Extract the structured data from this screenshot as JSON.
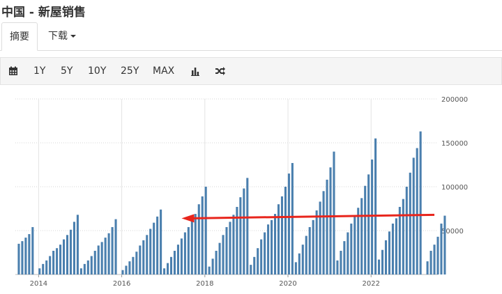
{
  "header": {
    "title": "中国 - 新屋销售"
  },
  "tabs": [
    {
      "label": "摘要",
      "active": true
    },
    {
      "label": "下载",
      "dropdown": true
    }
  ],
  "toolbar": {
    "calendar_icon": "calendar-icon",
    "ranges": [
      "1Y",
      "5Y",
      "10Y",
      "25Y",
      "MAX"
    ],
    "chart_type_icon": "bar-chart-icon",
    "compare_icon": "shuffle-icon"
  },
  "chart_data": {
    "type": "bar",
    "color": "#4a7fae",
    "title": "",
    "xlabel": "",
    "ylabel": "",
    "ylim": [
      0,
      200000
    ],
    "yticks": [
      50000,
      100000,
      150000,
      200000
    ],
    "xticks": [
      "2014",
      "2016",
      "2018",
      "2020",
      "2022"
    ],
    "series": [
      {
        "values": [
          [
            [
              "2013-08",
              35000
            ],
            [
              "2013-09",
              38000
            ],
            [
              "2013-10",
              42000
            ],
            [
              "2013-11",
              46000
            ],
            [
              "2013-12",
              54000
            ]
          ],
          [
            [
              "2014-02",
              7000
            ],
            [
              "2014-03",
              12000
            ],
            [
              "2014-04",
              16000
            ],
            [
              "2014-05",
              21000
            ],
            [
              "2014-06",
              27000
            ],
            [
              "2014-07",
              30000
            ],
            [
              "2014-08",
              34000
            ],
            [
              "2014-09",
              40000
            ],
            [
              "2014-10",
              45000
            ],
            [
              "2014-11",
              51000
            ],
            [
              "2014-12",
              60000
            ],
            [
              "2015-01",
              68000
            ]
          ],
          [
            [
              "2015-02",
              7000
            ],
            [
              "2015-03",
              12000
            ],
            [
              "2015-04",
              16000
            ],
            [
              "2015-05",
              21000
            ],
            [
              "2015-06",
              27000
            ],
            [
              "2015-07",
              33000
            ],
            [
              "2015-08",
              37000
            ],
            [
              "2015-09",
              42000
            ],
            [
              "2015-10",
              47000
            ],
            [
              "2015-11",
              54000
            ],
            [
              "2015-12",
              63000
            ]
          ],
          [
            [
              "2016-02",
              5000
            ],
            [
              "2016-03",
              10000
            ],
            [
              "2016-04",
              15000
            ],
            [
              "2016-05",
              20000
            ],
            [
              "2016-06",
              26000
            ],
            [
              "2016-07",
              33000
            ],
            [
              "2016-08",
              39000
            ],
            [
              "2016-09",
              45000
            ],
            [
              "2016-10",
              52000
            ],
            [
              "2016-11",
              59000
            ],
            [
              "2016-12",
              66000
            ],
            [
              "2017-01",
              74000
            ]
          ],
          [
            [
              "2017-02",
              7000
            ],
            [
              "2017-03",
              13000
            ],
            [
              "2017-04",
              20000
            ],
            [
              "2017-05",
              27000
            ],
            [
              "2017-06",
              34000
            ],
            [
              "2017-07",
              41000
            ],
            [
              "2017-08",
              48000
            ],
            [
              "2017-09",
              54000
            ],
            [
              "2017-10",
              62000
            ],
            [
              "2017-11",
              69000
            ],
            [
              "2017-12",
              80000
            ],
            [
              "2018-01",
              89000
            ],
            [
              "2018-02",
              100000
            ]
          ],
          [
            [
              "2018-03",
              9000
            ],
            [
              "2018-04",
              18000
            ],
            [
              "2018-05",
              27000
            ],
            [
              "2018-06",
              36000
            ],
            [
              "2018-07",
              45000
            ],
            [
              "2018-08",
              54000
            ],
            [
              "2018-09",
              60000
            ],
            [
              "2018-10",
              68000
            ],
            [
              "2018-11",
              77000
            ],
            [
              "2018-12",
              88000
            ],
            [
              "2019-01",
              98000
            ],
            [
              "2019-02",
              110000
            ]
          ],
          [
            [
              "2019-03",
              11000
            ],
            [
              "2019-04",
              20000
            ],
            [
              "2019-05",
              30000
            ],
            [
              "2019-06",
              40000
            ],
            [
              "2019-07",
              48000
            ],
            [
              "2019-08",
              57000
            ],
            [
              "2019-09",
              62000
            ],
            [
              "2019-10",
              69000
            ],
            [
              "2019-11",
              80000
            ],
            [
              "2019-12",
              89000
            ],
            [
              "2020-01",
              100000
            ],
            [
              "2020-02",
              115000
            ],
            [
              "2020-03",
              127000
            ]
          ],
          [
            [
              "2020-04",
              14000
            ],
            [
              "2020-05",
              24000
            ],
            [
              "2020-06",
              34000
            ],
            [
              "2020-07",
              44000
            ],
            [
              "2020-08",
              54000
            ],
            [
              "2020-09",
              62000
            ],
            [
              "2020-10",
              73000
            ],
            [
              "2020-11",
              83000
            ],
            [
              "2020-12",
              95000
            ],
            [
              "2021-01",
              108000
            ],
            [
              "2021-02",
              122000
            ],
            [
              "2021-03",
              140000
            ]
          ],
          [
            [
              "2021-04",
              16000
            ],
            [
              "2021-05",
              27000
            ],
            [
              "2021-06",
              38000
            ],
            [
              "2021-07",
              48000
            ],
            [
              "2021-08",
              58000
            ],
            [
              "2021-09",
              66000
            ],
            [
              "2021-10",
              76000
            ],
            [
              "2021-11",
              87000
            ],
            [
              "2021-12",
              101000
            ],
            [
              "2022-01",
              114000
            ],
            [
              "2022-02",
              131000
            ],
            [
              "2022-03",
              155000
            ]
          ],
          [
            [
              "2022-04",
              17000
            ],
            [
              "2022-05",
              28000
            ],
            [
              "2022-06",
              39000
            ],
            [
              "2022-07",
              49000
            ],
            [
              "2022-08",
              58000
            ],
            [
              "2022-09",
              64000
            ],
            [
              "2022-10",
              77000
            ],
            [
              "2022-11",
              86000
            ],
            [
              "2022-12",
              100000
            ],
            [
              "2023-01",
              116000
            ],
            [
              "2023-02",
              133000
            ],
            [
              "2023-03",
              144000
            ],
            [
              "2023-04",
              163000
            ]
          ],
          [
            [
              "2023-06",
              15000
            ],
            [
              "2023-07",
              27000
            ],
            [
              "2023-08",
              34000
            ],
            [
              "2023-09",
              43000
            ],
            [
              "2023-10",
              58000
            ],
            [
              "2023-11",
              67000
            ]
          ]
        ]
      }
    ],
    "annotation": {
      "type": "arrow",
      "color": "#e8251c",
      "from_value": 68000,
      "to_value": 64000
    }
  }
}
